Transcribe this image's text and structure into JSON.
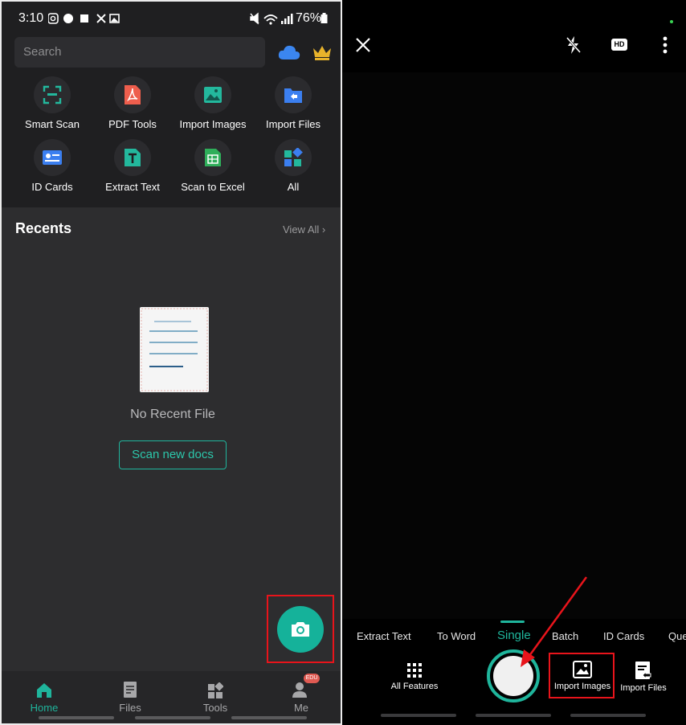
{
  "left": {
    "status": {
      "time": "3:10",
      "battery": "76%"
    },
    "search": {
      "placeholder": "Search"
    },
    "tools": [
      {
        "label": "Smart Scan",
        "icon": "smart-scan-icon"
      },
      {
        "label": "PDF Tools",
        "icon": "pdf-icon"
      },
      {
        "label": "Import Images",
        "icon": "image-icon"
      },
      {
        "label": "Import Files",
        "icon": "folder-icon"
      },
      {
        "label": "ID Cards",
        "icon": "id-card-icon"
      },
      {
        "label": "Extract Text",
        "icon": "text-icon"
      },
      {
        "label": "Scan to Excel",
        "icon": "excel-icon"
      },
      {
        "label": "All",
        "icon": "grid-icon"
      }
    ],
    "recents": {
      "title": "Recents",
      "view_all": "View All"
    },
    "empty": {
      "message": "No Recent File",
      "button": "Scan new docs"
    },
    "nav": [
      {
        "label": "Home",
        "active": true
      },
      {
        "label": "Files",
        "active": false
      },
      {
        "label": "Tools",
        "active": false
      },
      {
        "label": "Me",
        "active": false
      }
    ],
    "edu_badge": "EDU"
  },
  "right": {
    "modes": [
      "Extract Text",
      "To Word",
      "Single",
      "Batch",
      "ID Cards",
      "Que"
    ],
    "active_mode": "Single",
    "hd_label": "HD",
    "bottom": {
      "all_features": "All Features",
      "import_images": "Import Images",
      "import_files": "Import Files"
    }
  },
  "colors": {
    "accent": "#15b29a",
    "highlight_red": "#e8141b",
    "dark_bg": "#2d2d2f"
  }
}
